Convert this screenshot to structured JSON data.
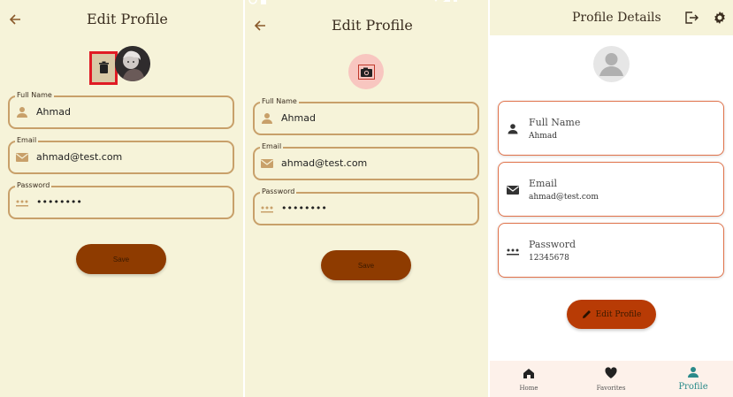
{
  "colors": {
    "background": "#f6f3d9",
    "field_border": "#c8a06a",
    "save_button": "#8e3b00",
    "card_border": "#e0724a",
    "edit_button": "#b83b05",
    "nav_active": "#2a8a8a",
    "highlight_box": "#e01b24"
  },
  "screen1": {
    "title": "Edit Profile",
    "back_icon": "arrow-left-icon",
    "delete_icon": "trash-icon",
    "fields": [
      {
        "label": "Full Name",
        "value": "Ahmad",
        "icon": "person-icon"
      },
      {
        "label": "Email",
        "value": "ahmad@test.com",
        "icon": "mail-icon"
      },
      {
        "label": "Password",
        "value": "••••••••",
        "icon": "password-icon"
      }
    ],
    "save_label": "Save"
  },
  "screen2": {
    "title": "Edit Profile",
    "back_icon": "arrow-left-icon",
    "camera_icon": "camera-icon",
    "fields": [
      {
        "label": "Full Name",
        "value": "Ahmad",
        "icon": "person-icon"
      },
      {
        "label": "Email",
        "value": "ahmad@test.com",
        "icon": "mail-icon"
      },
      {
        "label": "Password",
        "value": "••••••••",
        "icon": "password-icon"
      }
    ],
    "save_label": "Save"
  },
  "screen3": {
    "title": "Profile Details",
    "logout_icon": "logout-icon",
    "settings_icon": "gear-icon",
    "cards": [
      {
        "label": "Full Name",
        "value": "Ahmad",
        "icon": "person-icon"
      },
      {
        "label": "Email",
        "value": "ahmad@test.com",
        "icon": "mail-icon"
      },
      {
        "label": "Password",
        "value": "12345678",
        "icon": "password-icon"
      }
    ],
    "edit_label": "Edit Profile",
    "nav": [
      {
        "label": "Home",
        "icon": "home-icon"
      },
      {
        "label": "Favorites",
        "icon": "heart-icon"
      },
      {
        "label": "Profile",
        "icon": "person-icon",
        "active": true
      }
    ]
  }
}
